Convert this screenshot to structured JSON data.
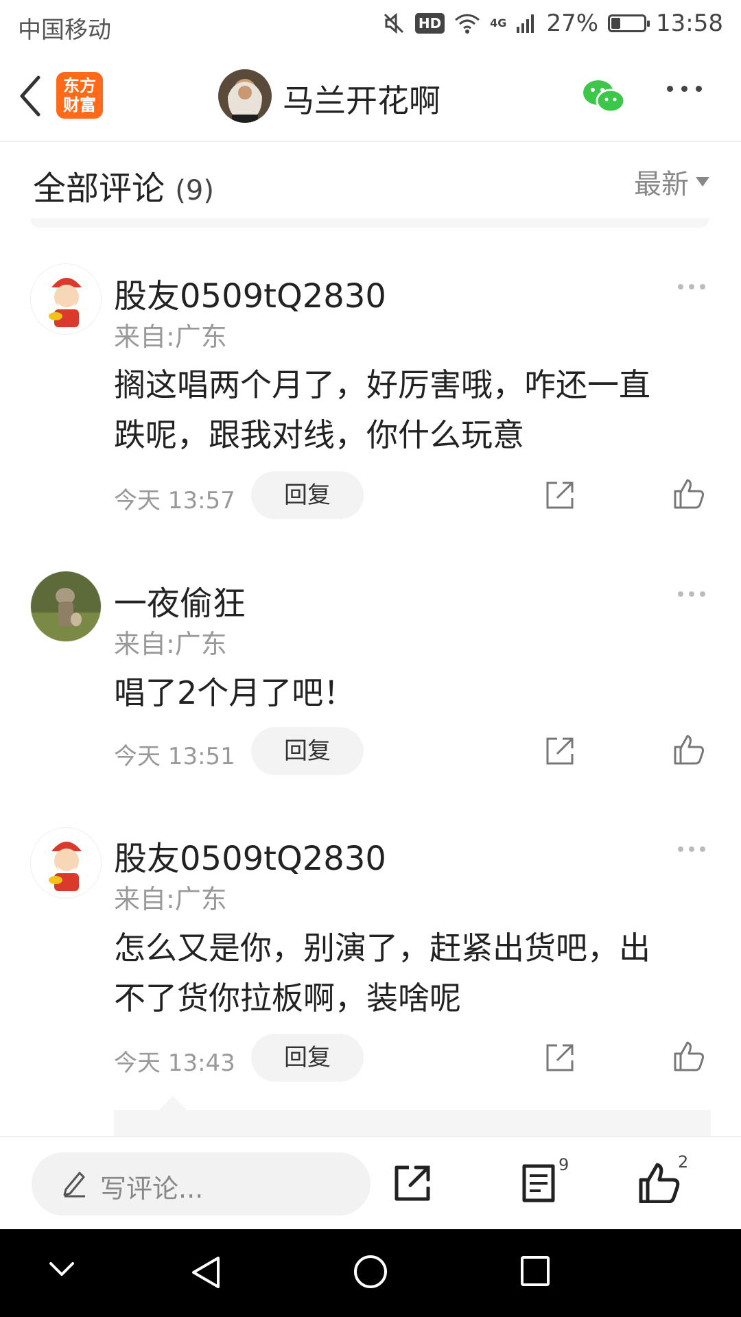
{
  "status_bar": {
    "carrier": "中国移动",
    "hd": "HD",
    "network": "4G",
    "battery": "27%",
    "time": "13:58"
  },
  "header": {
    "app_logo_line1": "东方",
    "app_logo_line2": "财富",
    "author_name": "马兰开花啊"
  },
  "comments_section": {
    "title": "全部评论",
    "count": "(9)",
    "sort_label": "最新"
  },
  "comments": [
    {
      "username": "股友0509tQ2830",
      "location": "来自:广东",
      "text_line1": "搁这唱两个月了，好厉害哦，咋还一直",
      "text_line2": "跌呢，跟我对线，你什么玩意",
      "time": "今天 13:57",
      "reply_label": "回复"
    },
    {
      "username": "一夜偷狂",
      "location": "来自:广东",
      "text_line1": "唱了2个月了吧！",
      "time": "今天 13:51",
      "reply_label": "回复"
    },
    {
      "username": "股友0509tQ2830",
      "location": "来自:广东",
      "text_line1": "怎么又是你，别演了，赶紧出货吧，出",
      "text_line2": "不了货你拉板啊，装啥呢",
      "time": "今天 13:43",
      "reply_label": "回复"
    }
  ],
  "bottom_bar": {
    "write_placeholder": "写评论...",
    "comment_count": "9",
    "like_count": "2"
  },
  "colors": {
    "brand": "#ff6a1a",
    "wechat": "#3cc64a",
    "muted": "#999999"
  },
  "icons": [
    "back-icon",
    "wechat-icon",
    "more-icon",
    "share-icon",
    "like-icon",
    "pencil-icon",
    "comment-list-icon",
    "nav-back-icon",
    "nav-home-icon",
    "nav-recent-icon",
    "nav-down-icon"
  ]
}
